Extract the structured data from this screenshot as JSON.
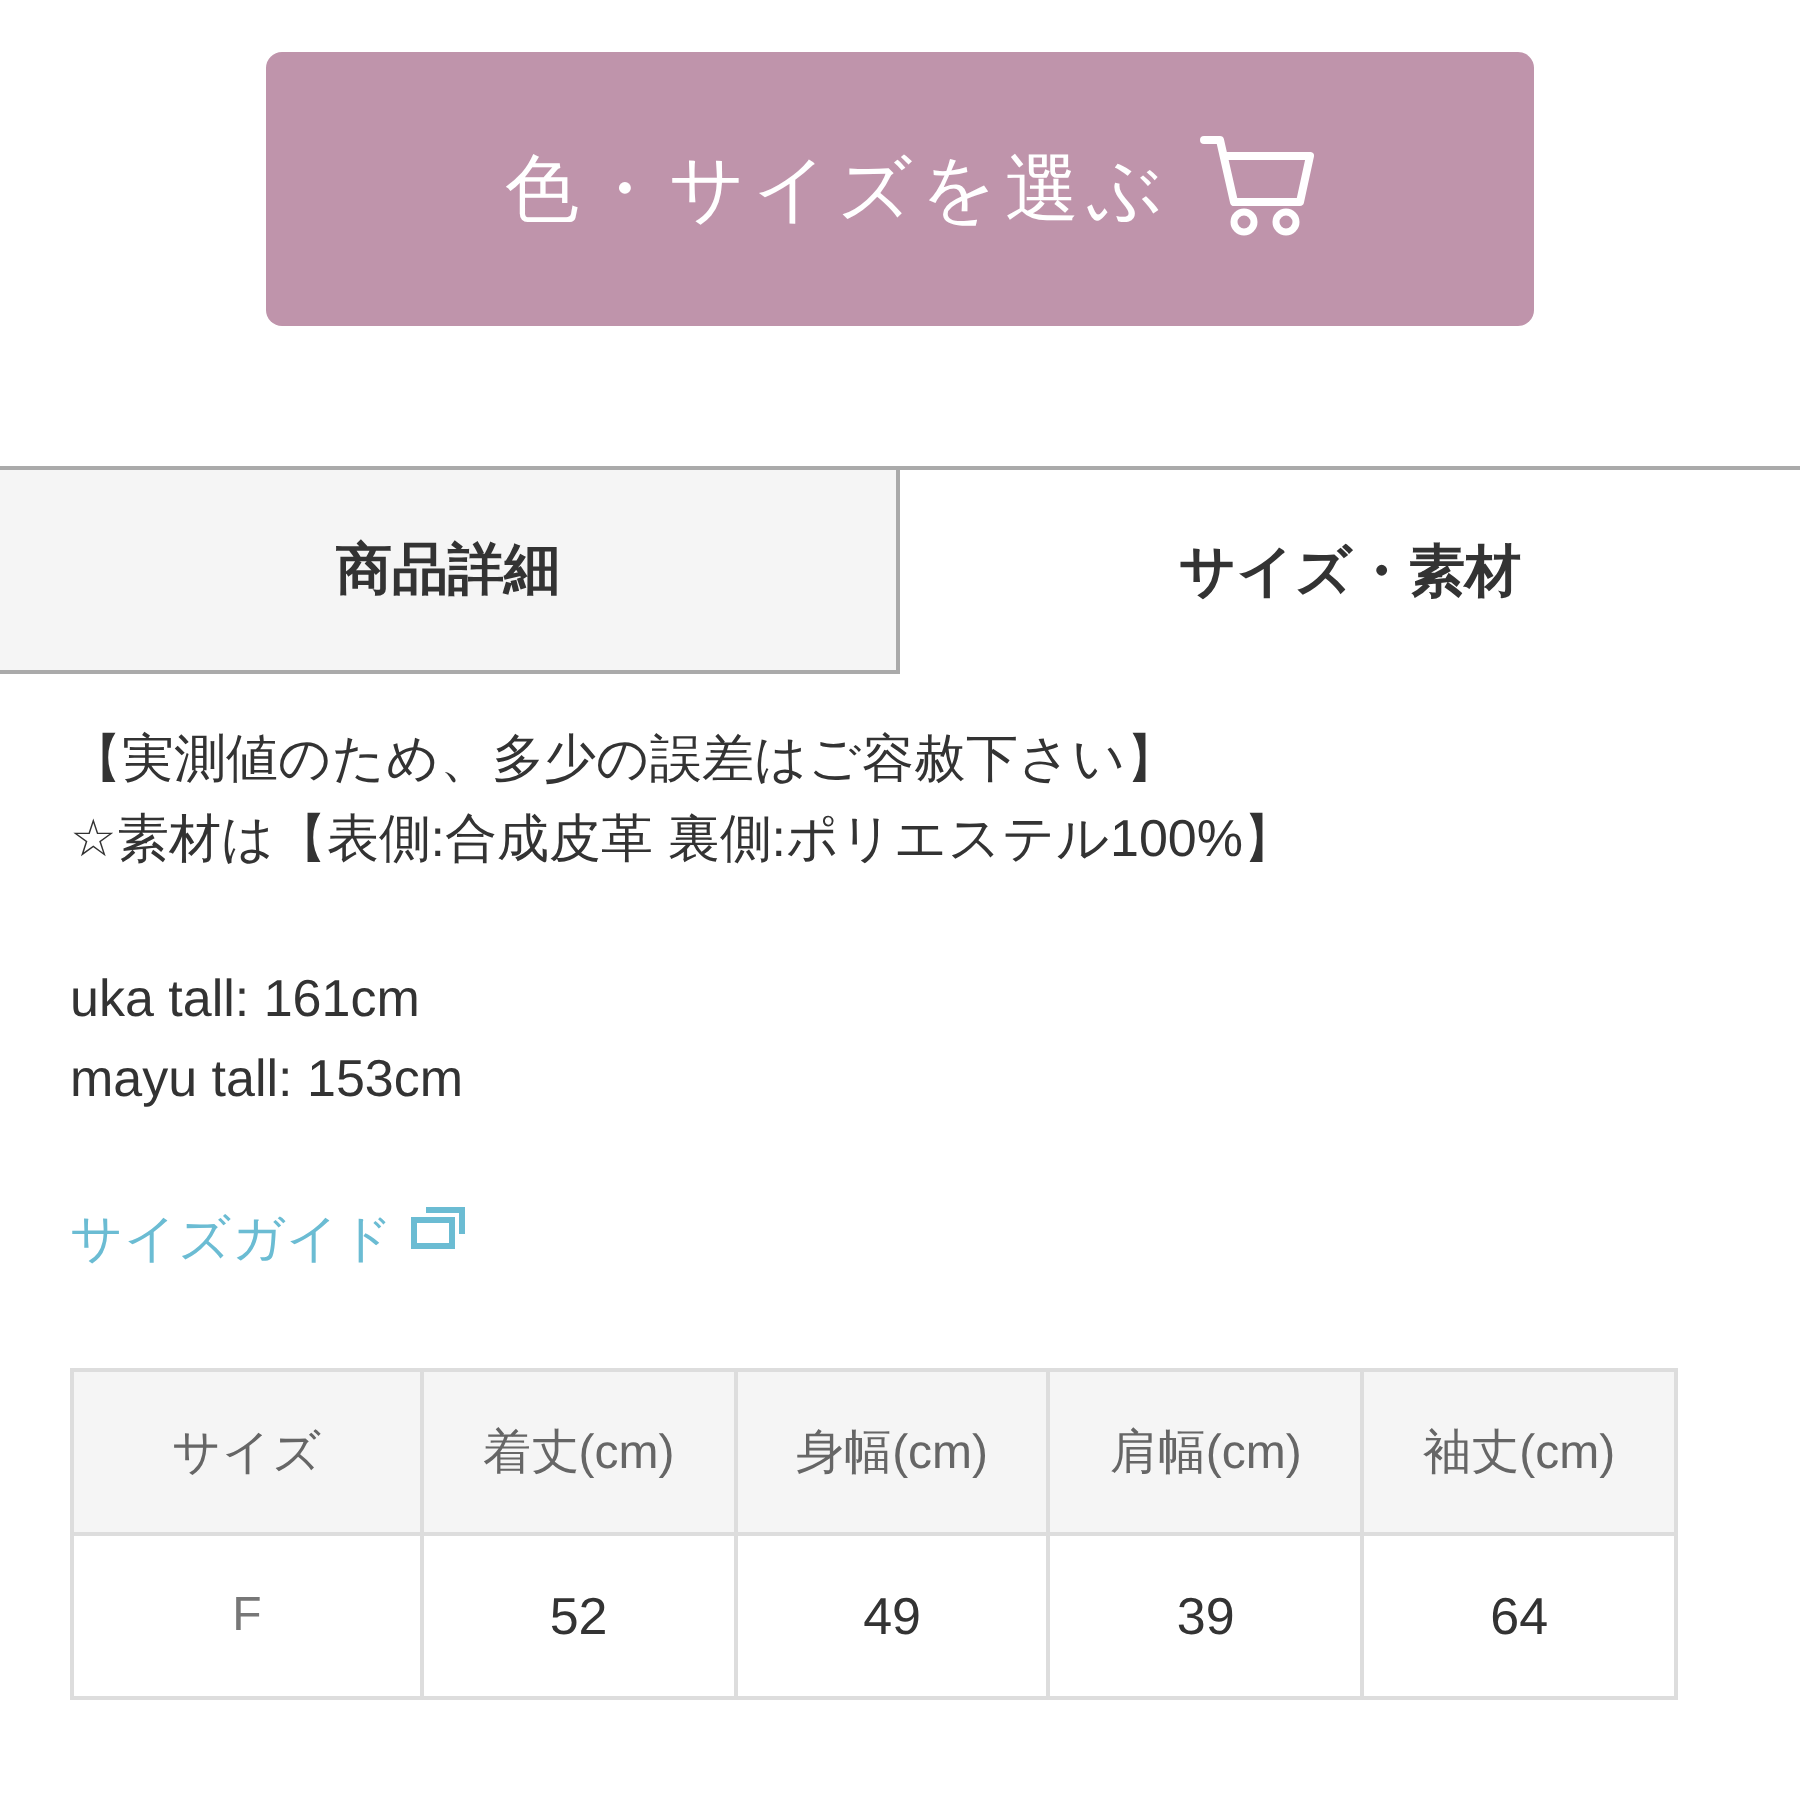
{
  "select_button": {
    "label": "色・サイズを選ぶ"
  },
  "tabs": [
    {
      "label": "商品詳細",
      "selected": false
    },
    {
      "label": "サイズ・素材",
      "selected": true
    }
  ],
  "notes": [
    "【実測値のため、多少の誤差はご容赦下さい】",
    "☆素材は【表側:合成皮革 裏側:ポリエステル100%】"
  ],
  "model_heights": [
    "uka tall: 161cm",
    "mayu tall: 153cm"
  ],
  "size_guide_link": {
    "label": "サイズガイド"
  },
  "size_table": {
    "columns": [
      "サイズ",
      "着丈(cm)",
      "身幅(cm)",
      "肩幅(cm)",
      "袖丈(cm)"
    ],
    "rows": [
      [
        "F",
        "52",
        "49",
        "39",
        "64"
      ]
    ]
  }
}
